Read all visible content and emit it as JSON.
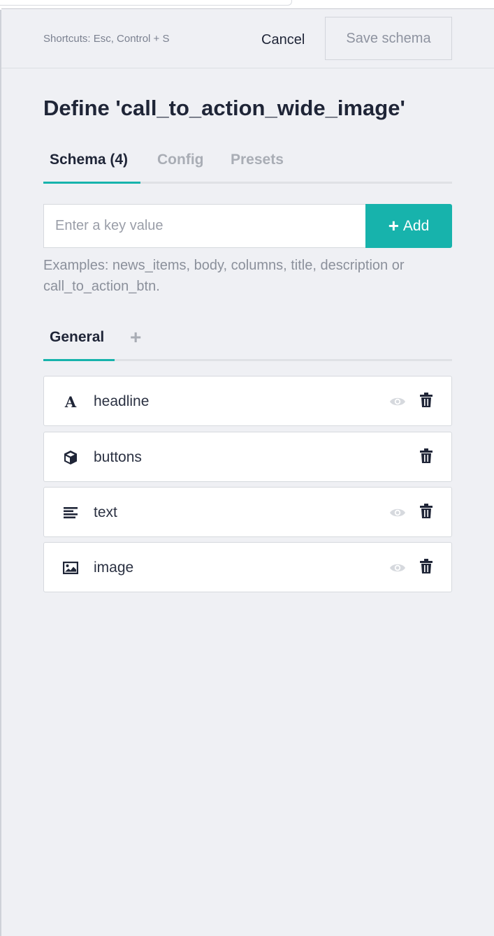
{
  "header": {
    "shortcuts": "Shortcuts: Esc, Control + S",
    "cancel_label": "Cancel",
    "save_label": "Save schema"
  },
  "title": "Define 'call_to_action_wide_image'",
  "tabs": [
    {
      "label": "Schema (4)",
      "active": true
    },
    {
      "label": "Config",
      "active": false
    },
    {
      "label": "Presets",
      "active": false
    }
  ],
  "key_input": {
    "placeholder": "Enter a key value",
    "value": ""
  },
  "add_button": {
    "icon": "plus-icon",
    "label": "Add"
  },
  "hint": "Examples: news_items, body, columns, title, description or call_to_action_btn.",
  "groups": {
    "active_label": "General",
    "add_icon": "plus-icon"
  },
  "fields": [
    {
      "name": "headline",
      "icon": "text-type-icon",
      "visibility_toggle": true
    },
    {
      "name": "buttons",
      "icon": "cube-icon",
      "visibility_toggle": false
    },
    {
      "name": "text",
      "icon": "align-left-icon",
      "visibility_toggle": true
    },
    {
      "name": "image",
      "icon": "image-icon",
      "visibility_toggle": true
    }
  ],
  "colors": {
    "accent": "#17b3ac",
    "background": "#eff0f4",
    "text_dark": "#1f2537",
    "text_muted": "#a9adb5"
  }
}
